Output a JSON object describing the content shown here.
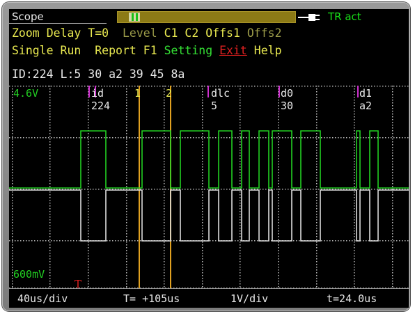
{
  "app": {
    "title": "Scope",
    "trigger_status": "TR act"
  },
  "menu": {
    "row1": [
      {
        "label": "Zoom",
        "color": "#e8e850",
        "enabled": true
      },
      {
        "label": "Delay",
        "color": "#e8e850",
        "enabled": true
      },
      {
        "label": "T=0",
        "color": "#e8e850",
        "enabled": true
      },
      {
        "label": "Level",
        "color": "#9a9a48",
        "enabled": false
      },
      {
        "label": "C1",
        "color": "#e8e850",
        "enabled": true
      },
      {
        "label": "C2",
        "color": "#e8e850",
        "enabled": true
      },
      {
        "label": "Offs1",
        "color": "#e8e850",
        "enabled": true
      },
      {
        "label": "Offs2",
        "color": "#9a9a48",
        "enabled": false
      }
    ],
    "row2": [
      {
        "label": "Single",
        "color": "#e8e850"
      },
      {
        "label": "Run",
        "color": "#e8e850"
      },
      {
        "label": "Report",
        "color": "#e8e850"
      },
      {
        "label": "F1",
        "color": "#e8e850"
      },
      {
        "label": "Setting",
        "color": "#34e034"
      },
      {
        "label": "Exit",
        "color": "#e02020"
      },
      {
        "label": "Help",
        "color": "#e8e850"
      }
    ]
  },
  "decode_line": "ID:224 L:5 30 a2 39 45 8a",
  "plot": {
    "ch1_level": "4.6V",
    "ch2_level": "600mV",
    "trigger_marker": "T",
    "cursors": [
      "1",
      "2"
    ],
    "fields": [
      {
        "name": "id",
        "value": "224"
      },
      {
        "name": "dlc",
        "value": "5"
      },
      {
        "name": "d0",
        "value": "30"
      },
      {
        "name": "d1",
        "value": "a2"
      }
    ]
  },
  "status": {
    "timebase": "40us/div",
    "delay": "T= +105us",
    "volts_per_div": "1V/div",
    "time": "t=24.0us"
  },
  "colors": {
    "trace1": "#22d022",
    "trace2": "#dcdcdc",
    "cursor": "#e0a020",
    "field_marker": "#d030d0",
    "grid": "#b8b8b8"
  }
}
